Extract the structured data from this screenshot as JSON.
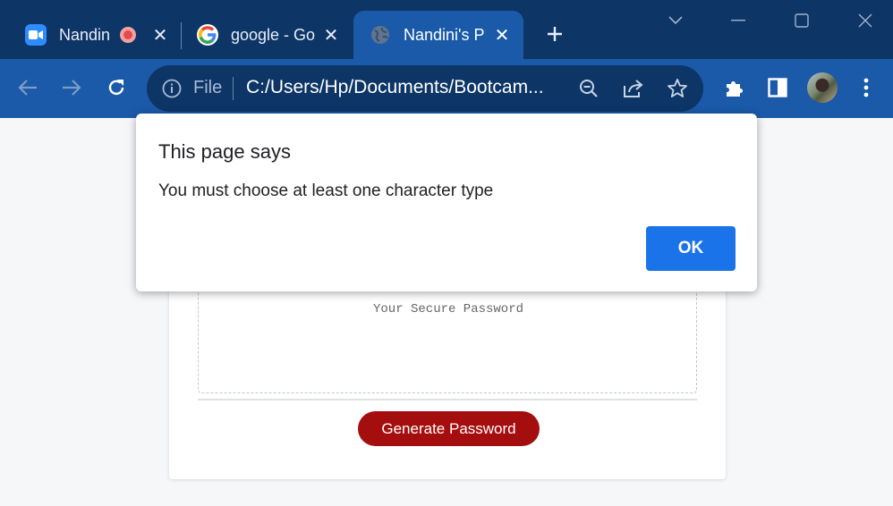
{
  "browser": {
    "tabs": [
      {
        "title": "Nandin",
        "favicon": "zoom-icon",
        "recording": true
      },
      {
        "title": "google - Go",
        "favicon": "google-icon"
      },
      {
        "title": "Nandini's P",
        "favicon": "globe-icon",
        "active": true
      }
    ],
    "new_tab_icon": "plus-icon",
    "window_controls": [
      "tab-search-icon",
      "minimize-icon",
      "maximize-icon",
      "close-icon"
    ]
  },
  "toolbar": {
    "back_icon": "back-arrow-icon",
    "forward_icon": "forward-arrow-icon",
    "reload_icon": "reload-icon",
    "omnibox": {
      "scheme_label": "File",
      "url": "C:/Users/Hp/Documents/Bootcam...",
      "icons": [
        "zoom-lens-icon",
        "share-icon",
        "bookmark-star-icon"
      ]
    },
    "right_icons": [
      "extensions-icon",
      "side-panel-icon",
      "profile-avatar",
      "menu-icon"
    ]
  },
  "page": {
    "password_placeholder": "Your Secure Password",
    "generate_button": "Generate Password"
  },
  "dialog": {
    "title": "This page says",
    "message": "You must choose at least one character type",
    "ok_label": "OK"
  },
  "colors": {
    "tabstrip_bg": "#0d3566",
    "toolbar_bg": "#1a5aa8",
    "generate_btn": "#a50e0e",
    "dialog_ok": "#1a73e8"
  }
}
